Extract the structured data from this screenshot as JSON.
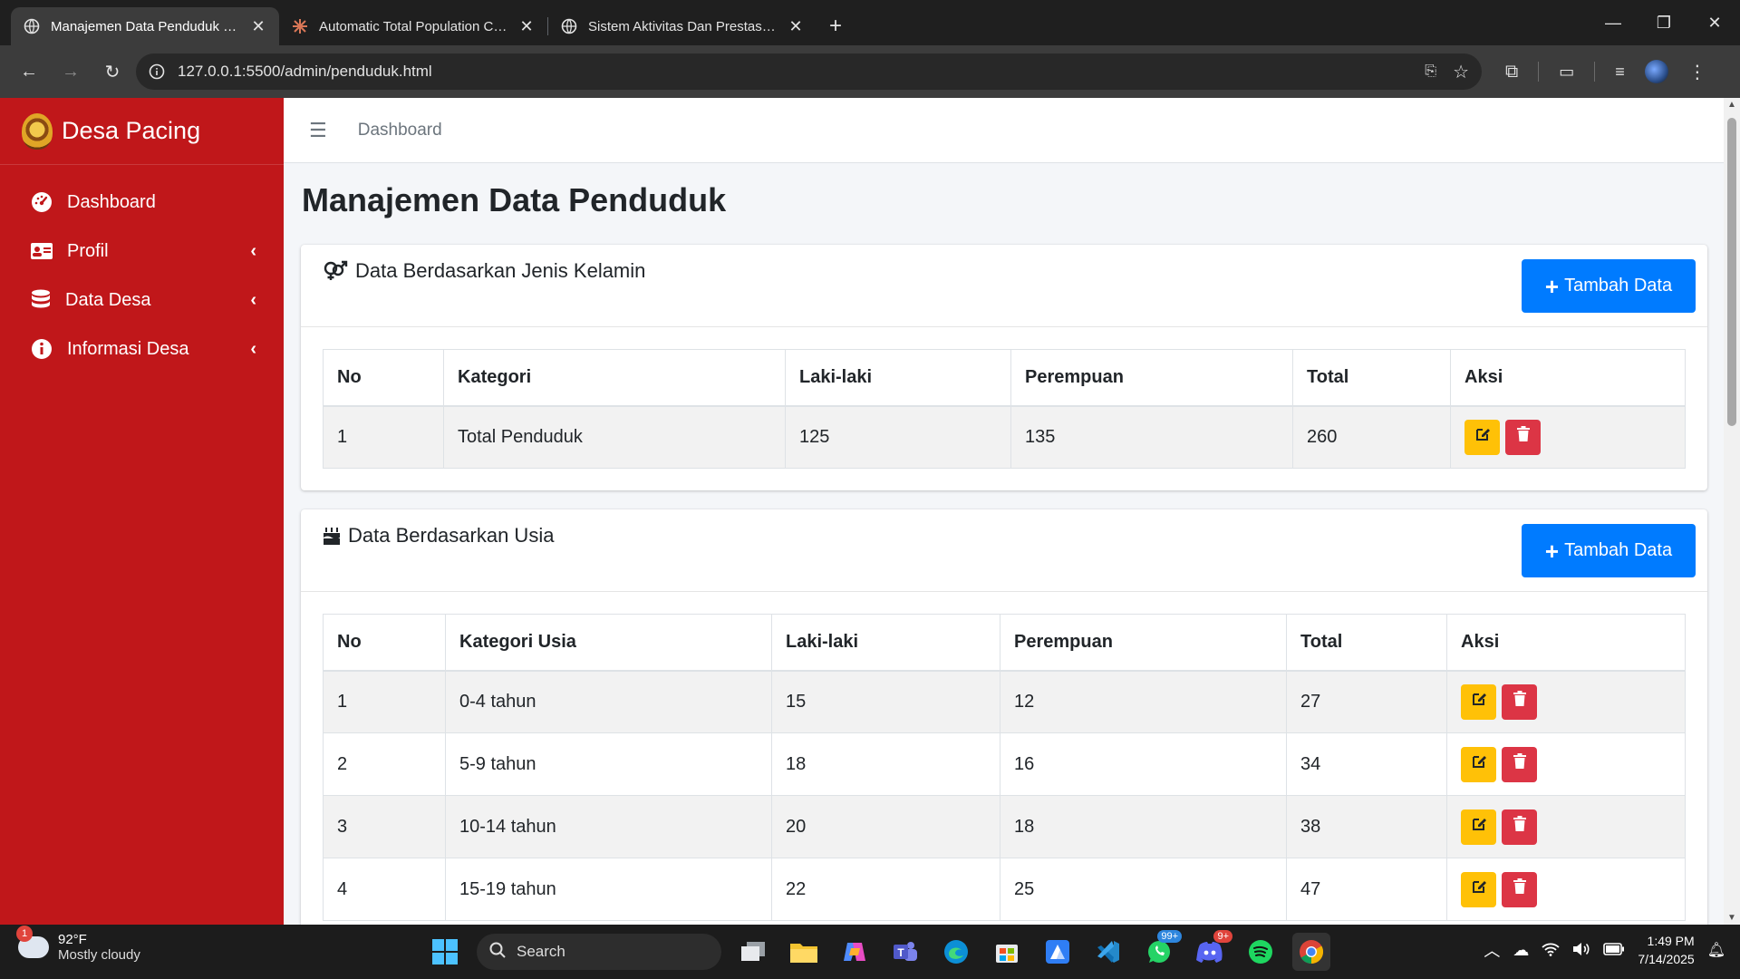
{
  "browser": {
    "tabs": [
      {
        "title": "Manajemen Data Penduduk - D",
        "active": true
      },
      {
        "title": "Automatic Total Population Calc",
        "active": false
      },
      {
        "title": "Sistem Aktivitas Dan Prestasi M",
        "active": false
      }
    ],
    "url": "127.0.0.1:5500/admin/penduduk.html"
  },
  "sidebar": {
    "brand": "Desa Pacing",
    "items": [
      {
        "label": "Dashboard",
        "icon": "tachometer-icon",
        "has_children": false
      },
      {
        "label": "Profil",
        "icon": "id-card-icon",
        "has_children": true
      },
      {
        "label": "Data Desa",
        "icon": "database-icon",
        "has_children": true
      },
      {
        "label": "Informasi Desa",
        "icon": "info-circle-icon",
        "has_children": true
      }
    ]
  },
  "topnav": {
    "crumb": "Dashboard"
  },
  "page": {
    "title": "Manajemen Data Penduduk"
  },
  "gender_card": {
    "title": "Data Berdasarkan Jenis Kelamin",
    "add_label": "Tambah Data",
    "headers": [
      "No",
      "Kategori",
      "Laki-laki",
      "Perempuan",
      "Total",
      "Aksi"
    ],
    "rows": [
      [
        "1",
        "Total Penduduk",
        "125",
        "135",
        "260"
      ]
    ]
  },
  "age_card": {
    "title": "Data Berdasarkan Usia",
    "add_label": "Tambah Data",
    "headers": [
      "No",
      "Kategori Usia",
      "Laki-laki",
      "Perempuan",
      "Total",
      "Aksi"
    ],
    "rows": [
      [
        "1",
        "0-4 tahun",
        "15",
        "12",
        "27"
      ],
      [
        "2",
        "5-9 tahun",
        "18",
        "16",
        "34"
      ],
      [
        "3",
        "10-14 tahun",
        "20",
        "18",
        "38"
      ],
      [
        "4",
        "15-19 tahun",
        "22",
        "25",
        "47"
      ]
    ]
  },
  "taskbar": {
    "weather_temp": "92°F",
    "weather_desc": "Mostly cloudy",
    "weather_badge": "1",
    "search_label": "Search",
    "whatsapp_badge": "99+",
    "discord_badge": "9+",
    "time": "1:49 PM",
    "date": "7/14/2025"
  },
  "colors": {
    "sidebar": "#c0171a",
    "primary": "#007bff",
    "warning": "#ffc107",
    "danger": "#dc3545"
  }
}
